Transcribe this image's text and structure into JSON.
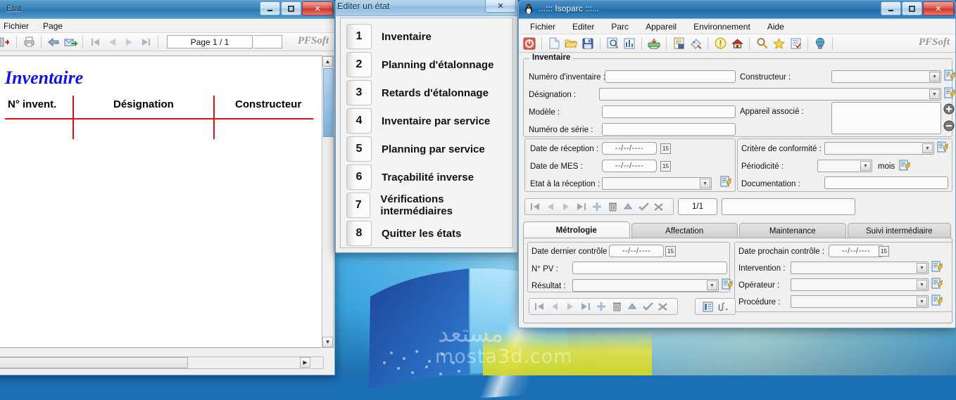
{
  "desktop": {
    "watermark_ar": "مستعد",
    "watermark_en": "mosta3d.com"
  },
  "report_window": {
    "title": "Etat",
    "menus": [
      "Fichier",
      "Page"
    ],
    "toolbar_icons": [
      "exit-icon",
      "print-icon",
      "back-arrow-icon",
      "export-mail-icon",
      "first-page-icon",
      "previous-page-icon",
      "next-page-icon",
      "last-page-icon"
    ],
    "page_indicator": "Page 1 / 1",
    "brand": "PFSoft",
    "report": {
      "title": "Inventaire",
      "columns": [
        "N° invent.",
        "Désignation",
        "Constructeur"
      ]
    },
    "window_buttons": [
      "minimize",
      "maximize",
      "close"
    ]
  },
  "etat_window": {
    "title": "Editer un état",
    "close_label": "✕",
    "items": [
      {
        "num": "1",
        "label": "Inventaire"
      },
      {
        "num": "2",
        "label": "Planning d'étalonnage"
      },
      {
        "num": "3",
        "label": "Retards d'étalonnage"
      },
      {
        "num": "4",
        "label": "Inventaire par service"
      },
      {
        "num": "5",
        "label": "Planning par service"
      },
      {
        "num": "6",
        "label": "Traçabilité inverse"
      },
      {
        "num": "7",
        "label": "Vérifications intermédiaires"
      },
      {
        "num": "8",
        "label": "Quitter les états"
      }
    ]
  },
  "isoparc_window": {
    "title": "...::: Isoparc :::...",
    "icon": "penguin-icon",
    "menus": [
      "Fichier",
      "Editer",
      "Parc",
      "Appareil",
      "Environnement",
      "Aide"
    ],
    "brand": "PFSoft",
    "toolbar_icons": [
      "power-off-icon",
      "new-document-icon",
      "open-folder-icon",
      "save-icon",
      "print-preview-icon",
      "statistics-icon",
      "printer-green-icon",
      "report-icon",
      "label-icon",
      "alert-icon",
      "home-icon",
      "search-icon",
      "favorite-star-icon",
      "checklist-icon",
      "globe-icon"
    ],
    "inventaire_group": {
      "legend": "Inventaire",
      "fields": [
        {
          "label": "Numéro d'inventaire :",
          "value": "",
          "type": "text"
        },
        {
          "label": "Désignation :",
          "value": "",
          "type": "text"
        },
        {
          "label": "Modèle :",
          "value": "",
          "type": "text"
        },
        {
          "label": "Numéro de série :",
          "value": "",
          "type": "text"
        },
        {
          "label": "Constructeur :",
          "value": "",
          "type": "combo"
        },
        {
          "label": "Appareil associé :",
          "value": "",
          "type": "listbox"
        }
      ],
      "associe_buttons": [
        "add-circle-icon",
        "remove-circle-icon"
      ]
    },
    "reception_group": {
      "fields": [
        {
          "label": "Date de réception :",
          "value": "--/--/----",
          "type": "date"
        },
        {
          "label": "Date de MES :",
          "value": "--/--/----",
          "type": "date"
        },
        {
          "label": "Etat à la réception :",
          "value": "",
          "type": "combo"
        }
      ]
    },
    "conformite_group": {
      "fields": [
        {
          "label": "Critère de conformité :",
          "value": "",
          "type": "combo"
        },
        {
          "label": "Périodicité :",
          "value": "",
          "type": "combo",
          "suffix": "mois"
        },
        {
          "label": "Documentation :",
          "value": "",
          "type": "text"
        }
      ]
    },
    "record_nav": {
      "buttons": [
        "first-record-icon",
        "previous-record-icon",
        "next-record-icon",
        "last-record-icon",
        "add-record-icon",
        "delete-record-icon",
        "edit-record-icon",
        "validate-record-icon",
        "cancel-record-icon"
      ],
      "counter": "1/1",
      "status": ""
    },
    "tabs": [
      {
        "label": "Métrologie",
        "active": true
      },
      {
        "label": "Affectation",
        "active": false
      },
      {
        "label": "Maintenance",
        "active": false
      },
      {
        "label": "Suivi intermédiaire",
        "active": false
      }
    ],
    "metrologie_panel": {
      "left_fields": [
        {
          "label": "Date dernier contrôle :",
          "value": "--/--/----",
          "type": "date"
        },
        {
          "label": "N° PV :",
          "value": "",
          "type": "text"
        },
        {
          "label": "Résultat :",
          "value": "",
          "type": "combo"
        }
      ],
      "right_fields": [
        {
          "label": "Date prochain contrôle :",
          "value": "--/--/----",
          "type": "date"
        },
        {
          "label": "Intervention :",
          "value": "",
          "type": "combo"
        },
        {
          "label": "Opérateur :",
          "value": "",
          "type": "combo"
        },
        {
          "label": "Procédure :",
          "value": "",
          "type": "combo"
        }
      ],
      "nav_buttons": [
        "first-record-icon",
        "previous-record-icon",
        "next-record-icon",
        "last-record-icon",
        "add-record-icon",
        "delete-record-icon",
        "edit-record-icon",
        "validate-record-icon",
        "cancel-record-icon"
      ],
      "extra_buttons": [
        "list-view-icon",
        "attachment-icon"
      ]
    }
  }
}
